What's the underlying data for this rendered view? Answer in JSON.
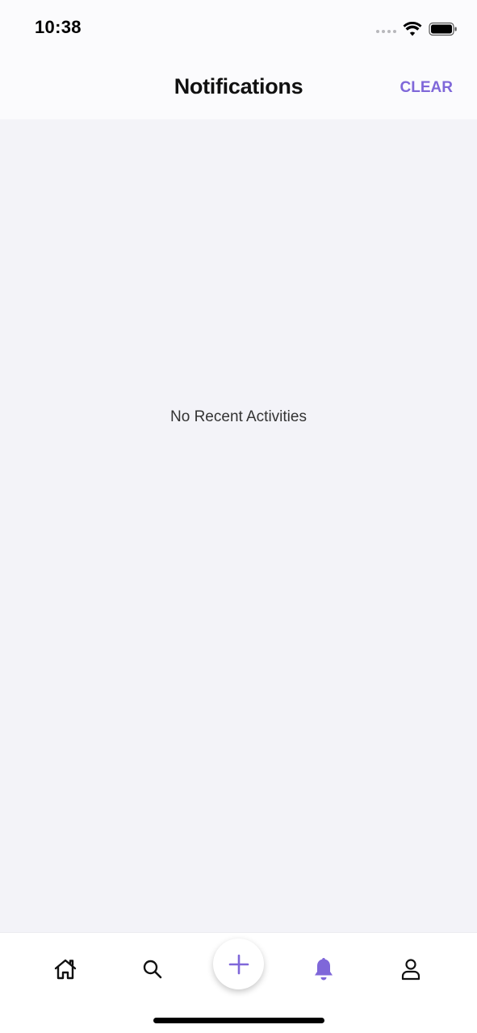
{
  "status_bar": {
    "time": "10:38"
  },
  "header": {
    "title": "Notifications",
    "clear_label": "CLEAR"
  },
  "content": {
    "empty_message": "No Recent Activities"
  },
  "tab_bar": {
    "items": [
      {
        "icon": "home-icon",
        "active": false
      },
      {
        "icon": "search-icon",
        "active": false
      },
      {
        "icon": "plus-icon",
        "active": false
      },
      {
        "icon": "bell-icon",
        "active": true
      },
      {
        "icon": "user-icon",
        "active": false
      }
    ]
  },
  "colors": {
    "accent": "#7f67d9",
    "background": "#f3f3f8",
    "header_background": "#fbfbfd"
  }
}
